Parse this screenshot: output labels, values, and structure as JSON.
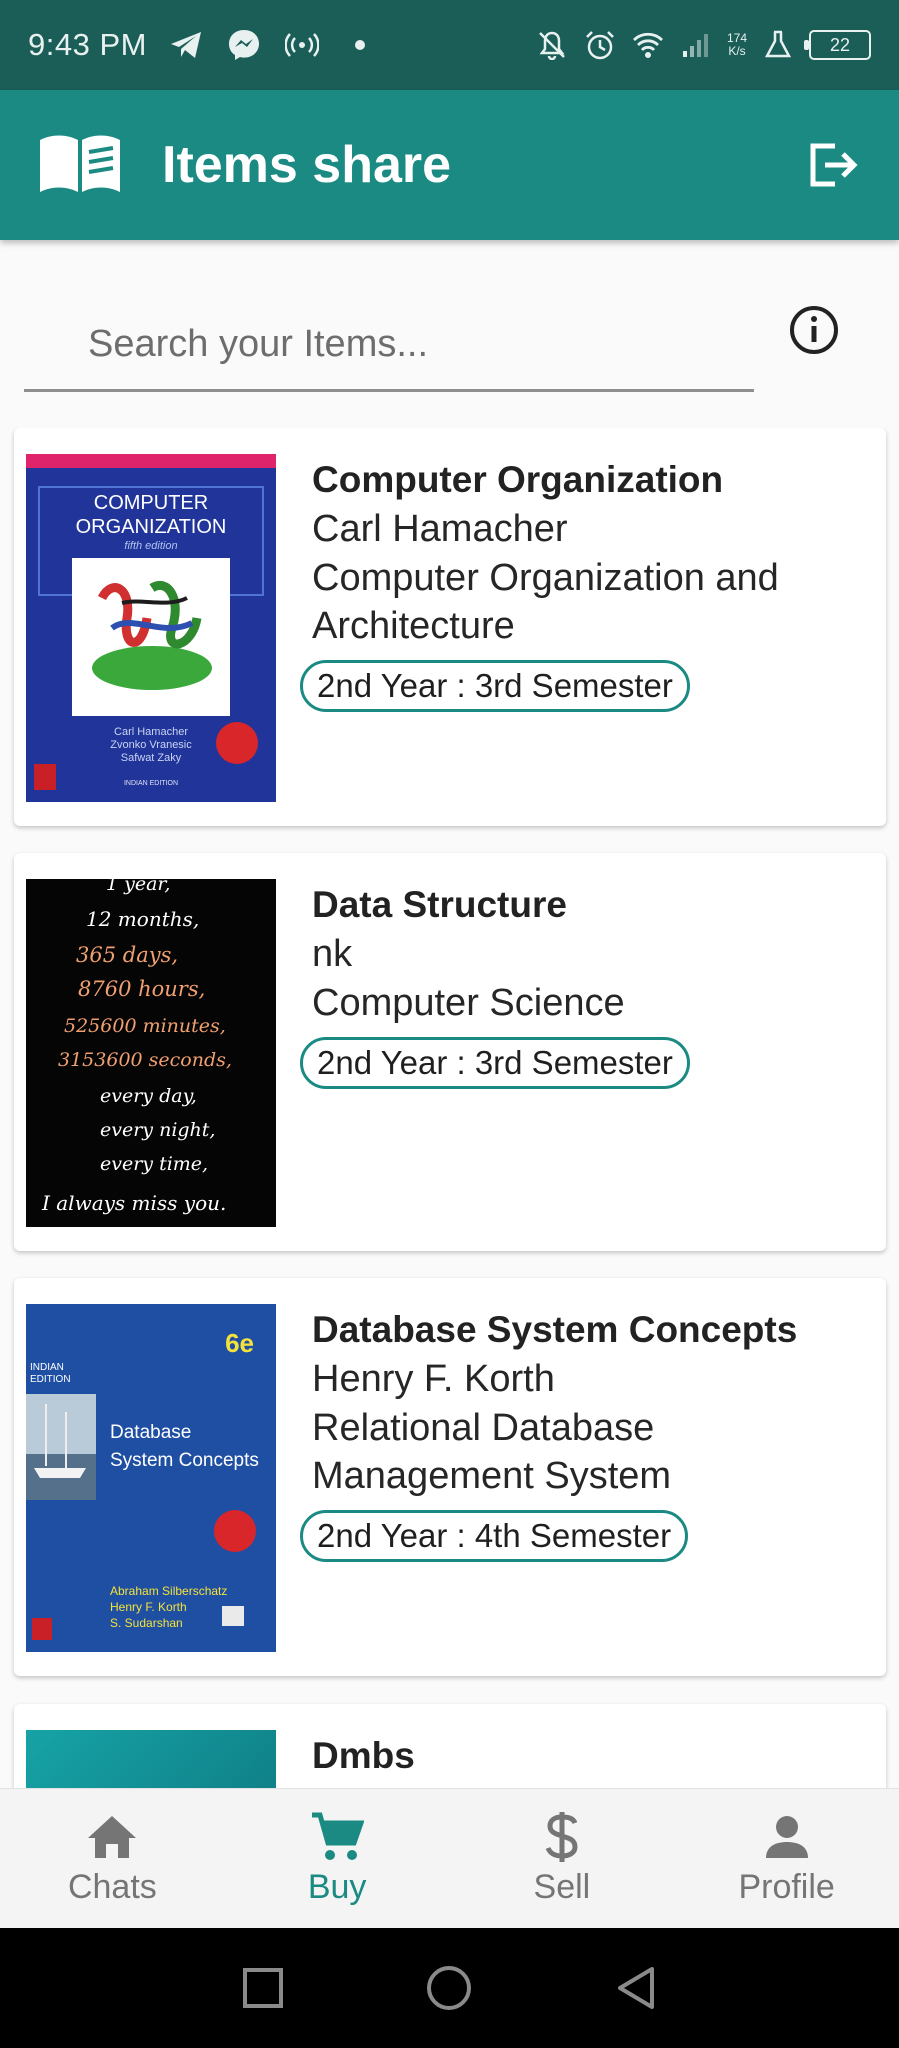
{
  "status_bar": {
    "time": "9:43 PM",
    "net_speed_value": "174",
    "net_speed_unit": "K/s",
    "battery": "22"
  },
  "app_bar": {
    "title": "Items share",
    "logo_icon": "open-book-icon",
    "logout_icon": "logout-icon"
  },
  "search": {
    "placeholder": "Search your Items..."
  },
  "items": [
    {
      "name": "Computer Organization",
      "author": "Carl Hamacher",
      "subject_line1": "Computer Organization and",
      "subject_line2": "Architecture",
      "chip": "2nd Year : 3rd Semester",
      "cover": {
        "title_line1": "COMPUTER",
        "title_line2": "ORGANIZATION",
        "edition": "fifth edition",
        "authors": [
          "Carl Hamacher",
          "Zvonko Vranesic",
          "Safwat Zaky"
        ],
        "imprint": "INDIAN EDITION"
      }
    },
    {
      "name": "Data Structure",
      "author": "nk",
      "subject_line1": "Computer Science",
      "subject_line2": "",
      "chip": "2nd Year : 3rd Semester",
      "cover": {
        "lines": [
          "1 year,",
          "12 months,",
          "365 days,",
          "8760 hours,",
          "525600 minutes,",
          "3153600 seconds,",
          "every day,",
          "every night,",
          "every time,",
          "I always miss you."
        ]
      }
    },
    {
      "name": "Database System Concepts",
      "author": "Henry F. Korth",
      "subject_line1": "Relational Database",
      "subject_line2": "Management System",
      "chip": "2nd Year : 4th Semester",
      "cover": {
        "edition": "6e",
        "badge": "INDIAN EDITION",
        "title_line1": "Database",
        "title_line2": "System Concepts",
        "authors": [
          "Abraham Silberschatz",
          "Henry F. Korth",
          "S. Sudarshan"
        ]
      }
    },
    {
      "name": "Dmbs",
      "author": "",
      "subject_line1": "",
      "subject_line2": "",
      "chip": ""
    }
  ],
  "bottom_nav": [
    {
      "label": "Chats",
      "icon": "home-icon",
      "active": false
    },
    {
      "label": "Buy",
      "icon": "cart-icon",
      "active": true
    },
    {
      "label": "Sell",
      "icon": "dollar-icon",
      "active": false
    },
    {
      "label": "Profile",
      "icon": "person-icon",
      "active": false
    }
  ],
  "colors": {
    "primary": "#1a8a82",
    "status_bar": "#1b5e58",
    "inactive": "#757575"
  }
}
